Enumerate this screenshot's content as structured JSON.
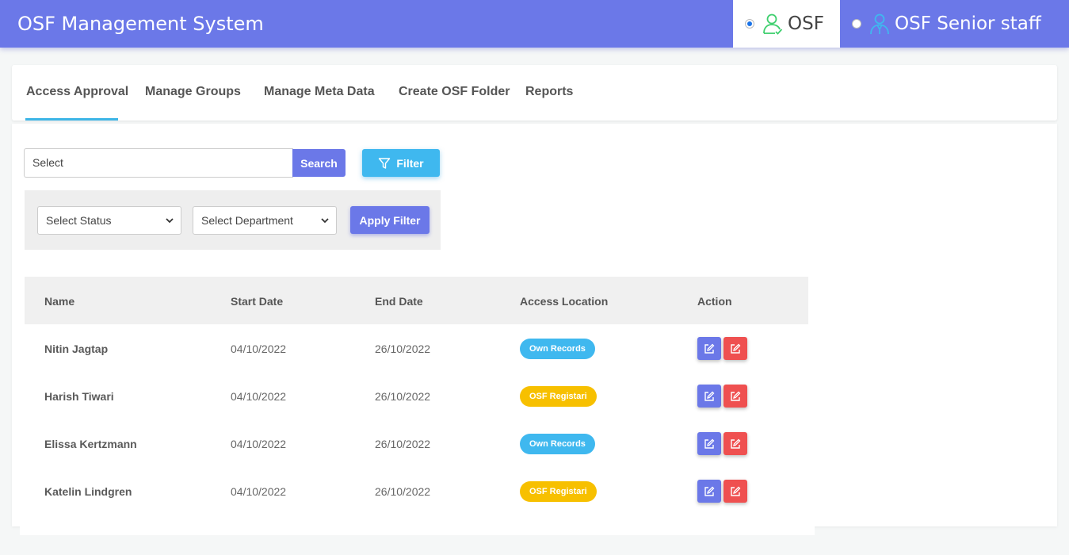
{
  "header": {
    "app_title": "OSF Management System",
    "roles": [
      {
        "label": "OSF",
        "selected": true,
        "icon": "user-icon",
        "icon_color": "#3ecf6e"
      },
      {
        "label": "OSF Senior staff",
        "selected": false,
        "icon": "staff-icon",
        "icon_color": "#3fb8ef"
      }
    ]
  },
  "tabs": [
    {
      "label": "Access Approval",
      "active": true
    },
    {
      "label": "Manage Groups",
      "active": false
    },
    {
      "label": "Manage Meta Data",
      "active": false
    },
    {
      "label": "Create OSF Folder",
      "active": false
    },
    {
      "label": "Reports",
      "active": false
    }
  ],
  "search": {
    "value": "Select",
    "button_label": "Search"
  },
  "filter_button_label": "Filter",
  "filters": {
    "status_selected": "Select Status",
    "department_selected": "Select Department",
    "apply_label": "Apply Filter"
  },
  "table": {
    "columns": [
      "Name",
      "Start Date",
      "End Date",
      "Access Location",
      "Action"
    ],
    "rows": [
      {
        "name": "Nitin Jagtap",
        "start": "04/10/2022",
        "end": "26/10/2022",
        "location": "Own Records",
        "location_color": "#3fb8ef"
      },
      {
        "name": "Harish Tiwari",
        "start": "04/10/2022",
        "end": "26/10/2022",
        "location": "OSF Registari",
        "location_color": "#f7c000"
      },
      {
        "name": "Elissa Kertzmann",
        "start": "04/10/2022",
        "end": "26/10/2022",
        "location": "Own Records",
        "location_color": "#3fb8ef"
      },
      {
        "name": "Katelin Lindgren",
        "start": "04/10/2022",
        "end": "26/10/2022",
        "location": "OSF Registari",
        "location_color": "#f7c000"
      }
    ]
  },
  "colors": {
    "primary": "#6b78e8",
    "info": "#3fb8ef",
    "danger": "#ef5050",
    "warning": "#f7c000"
  }
}
